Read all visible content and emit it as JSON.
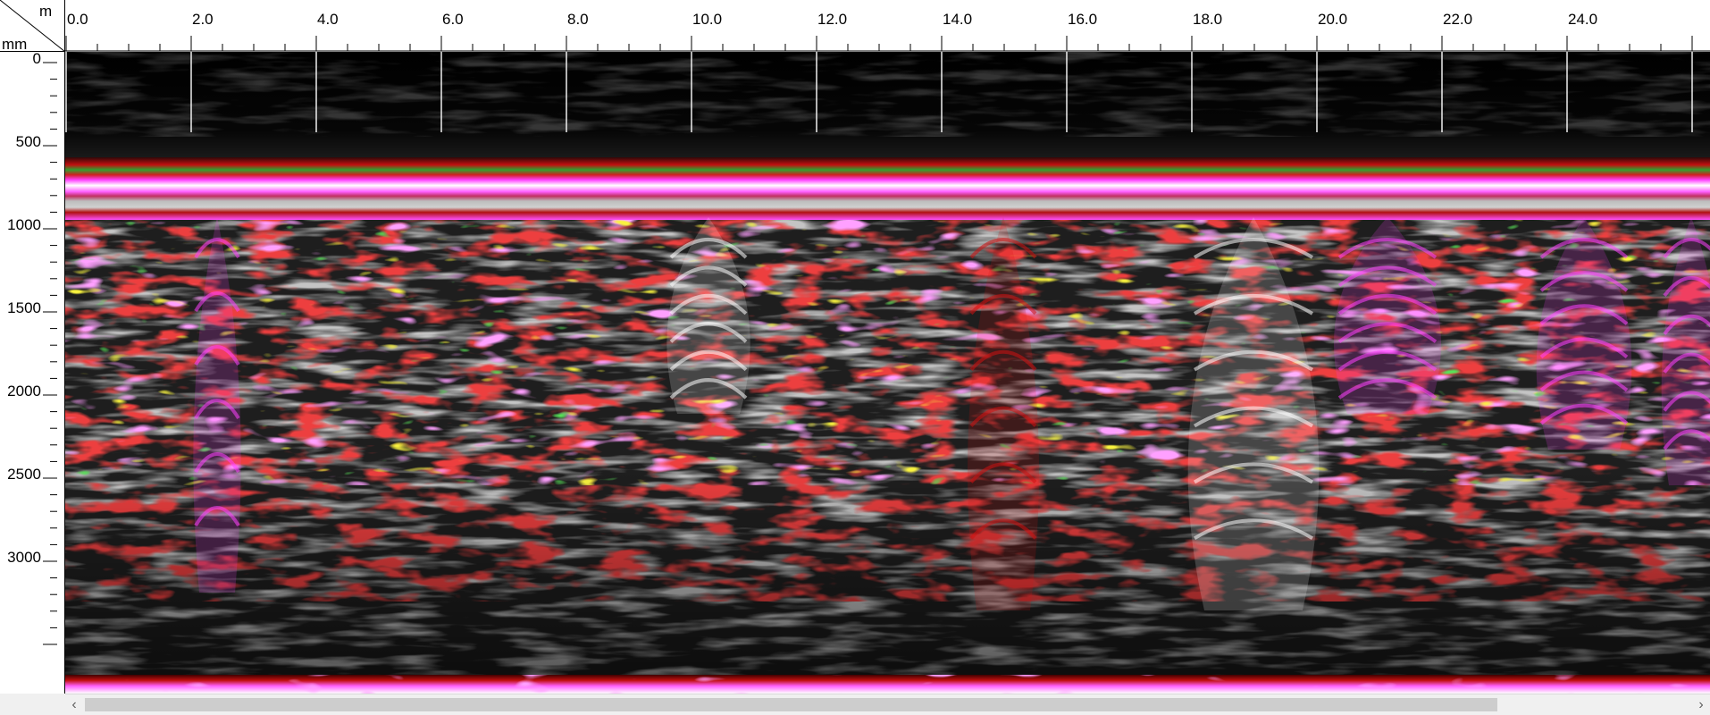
{
  "axes": {
    "x_unit": "m",
    "y_unit": "mm",
    "x_ticks": [
      "0.0",
      "2.0",
      "4.0",
      "6.0",
      "8.0",
      "10.0",
      "12.0",
      "14.0",
      "16.0",
      "18.0",
      "20.0",
      "22.0",
      "24.0"
    ],
    "y_ticks": [
      "0",
      "500",
      "1000",
      "1500",
      "2000",
      "2500",
      "3000"
    ]
  },
  "icons": {
    "scroll_left": "‹",
    "scroll_right": "›"
  },
  "colors": {
    "background": "#000000",
    "low_amplitude": "#4a4a4a",
    "mid_amplitude": "#d01010",
    "high_amplitude": "#ff40ff",
    "peak": "#ffffff",
    "accent_green": "#20c020",
    "accent_yellow": "#e8e000",
    "accent_purple": "#7030a0"
  },
  "scroll": {
    "position_fraction": 0.0,
    "visible_fraction": 0.88
  }
}
